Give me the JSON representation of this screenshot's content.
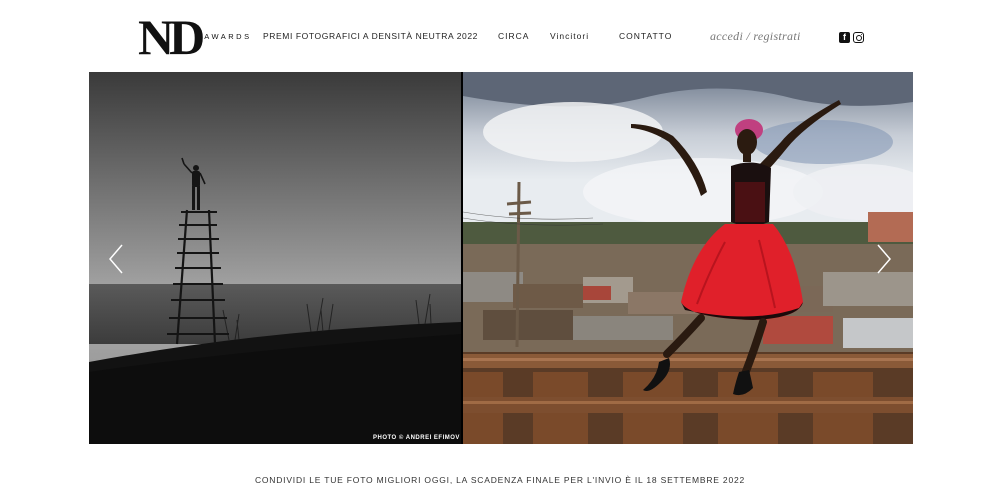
{
  "header": {
    "logo_main": "ND",
    "logo_sub": "AWARDS",
    "tagline": "PREMI FOTOGRAFICI A DENSITÀ NEUTRA 2022",
    "nav": [
      "CIRCA",
      "Vincitori",
      "CONTATTO"
    ],
    "login_label": "accedi",
    "separator": " / ",
    "register_label": "registrati",
    "social_icons": [
      "facebook-icon",
      "instagram-icon"
    ],
    "facebook_glyph": "f"
  },
  "slider": {
    "photo_credit": "PHOTO © ANDREI EFIMOV",
    "arrow_icons": [
      "chevron-left-icon",
      "chevron-right-icon"
    ]
  },
  "footer": {
    "announcement": "CONDIVIDI LE TUE FOTO MIGLIORI OGGI, LA SCADENZA FINALE PER L'INVIO È IL 18 SETTEMBRE 2022"
  }
}
